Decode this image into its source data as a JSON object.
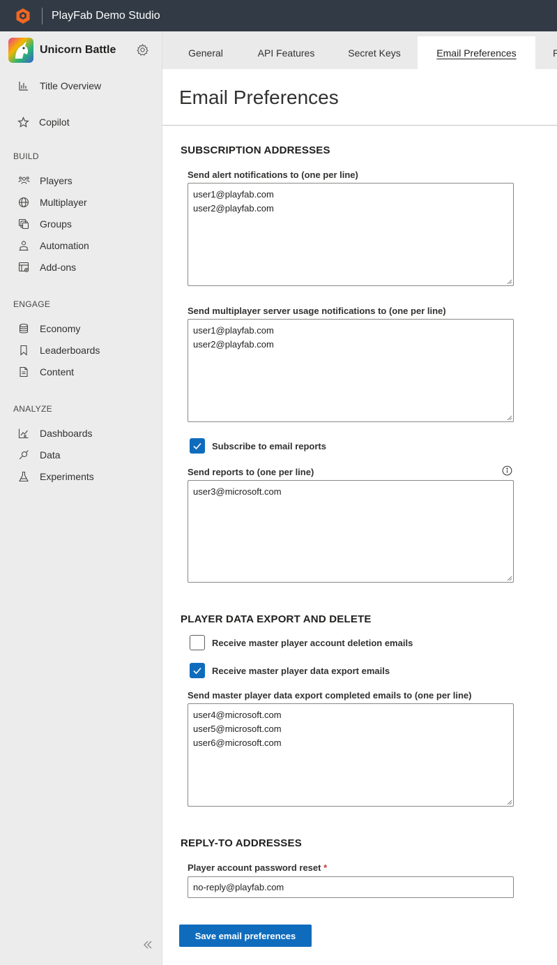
{
  "app": {
    "studio_name": "PlayFab Demo Studio",
    "logo_icon": "playfab-hexagon-icon",
    "brand_color": "#f26722"
  },
  "sidebar": {
    "title_name": "Unicorn Battle",
    "top_items": [
      {
        "label": "Title Overview",
        "icon": "bar-chart-icon"
      },
      {
        "label": "Copilot",
        "icon": "star-icon"
      }
    ],
    "sections": [
      {
        "label": "BUILD",
        "items": [
          {
            "label": "Players",
            "icon": "players-icon"
          },
          {
            "label": "Multiplayer",
            "icon": "globe-icon"
          },
          {
            "label": "Groups",
            "icon": "groups-icon"
          },
          {
            "label": "Automation",
            "icon": "robot-icon"
          },
          {
            "label": "Add-ons",
            "icon": "add-ons-icon"
          }
        ]
      },
      {
        "label": "ENGAGE",
        "items": [
          {
            "label": "Economy",
            "icon": "database-icon"
          },
          {
            "label": "Leaderboards",
            "icon": "bookmark-icon"
          },
          {
            "label": "Content",
            "icon": "document-icon"
          }
        ]
      },
      {
        "label": "ANALYZE",
        "items": [
          {
            "label": "Dashboards",
            "icon": "dashboard-icon"
          },
          {
            "label": "Data",
            "icon": "data-icon"
          },
          {
            "label": "Experiments",
            "icon": "flask-icon"
          }
        ]
      }
    ]
  },
  "tabs": [
    {
      "label": "General",
      "active": false
    },
    {
      "label": "API Features",
      "active": false
    },
    {
      "label": "Secret Keys",
      "active": false
    },
    {
      "label": "Email Preferences",
      "active": true
    },
    {
      "label": "P",
      "active": false
    }
  ],
  "main": {
    "page_title": "Email Preferences",
    "subscription": {
      "heading": "SUBSCRIPTION ADDRESSES",
      "alert_label": "Send alert notifications to (one per line)",
      "alert_lines": [
        "user1@playfab.com",
        "user2@playfab.com"
      ],
      "mp_label": "Send multiplayer server usage notifications to (one per line)",
      "mp_lines": [
        "user1@playfab.com",
        "user2@playfab.com"
      ],
      "subscribe_label": "Subscribe to email reports",
      "subscribe_checked": true,
      "reports_label": "Send reports to (one per line)",
      "reports_lines": [
        "user3@microsoft.com"
      ]
    },
    "export": {
      "heading": "PLAYER DATA EXPORT AND DELETE",
      "deletion_label": "Receive master player account deletion emails",
      "deletion_checked": false,
      "export_label": "Receive master player data export emails",
      "export_checked": true,
      "completed_label": "Send master player data export completed emails to (one per line)",
      "completed_lines": [
        "user4@microsoft.com",
        "user5@microsoft.com",
        "user6@microsoft.com"
      ]
    },
    "reply_to": {
      "heading": "REPLY-TO ADDRESSES",
      "reset_label": "Player account password reset",
      "required_mark": "*",
      "reset_value": "no-reply@playfab.com"
    },
    "save_label": "Save email preferences"
  },
  "colors": {
    "accent": "#0f6cbd",
    "topbar": "#323a45",
    "sidebar_bg": "#ececec",
    "required": "#d13438"
  }
}
